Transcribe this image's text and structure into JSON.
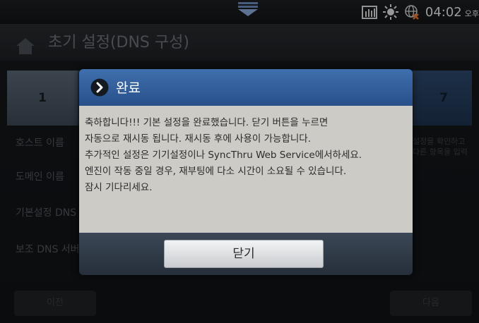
{
  "status_bar": {
    "time": "04:02",
    "ampm": "오후"
  },
  "header": {
    "title": "초기 설정(DNS 구성)"
  },
  "steps": {
    "first": "1",
    "last": "7"
  },
  "form": {
    "rows": [
      "호스트 이름",
      "도메인 이름",
      "기본설정 DNS",
      "보조 DNS 서버"
    ],
    "notes": [
      "설정을 확인하고",
      "다른 항목을 입력"
    ]
  },
  "dialog": {
    "title": "완료",
    "lines": [
      "축하합니다!!!  기본 설정을 완료했습니다. 닫기 버튼을 누르면",
      "자동으로 재시동 됩니다. 재시동 후에 사용이 가능합니다.",
      "추가적인 설정은 기기설정이나 SyncThru Web Service에서하세요.",
      "엔진이 작동 중일 경우, 재부팅에 다소 시간이 소요될 수 있습니다.",
      "잠시 기다리세요."
    ],
    "close_label": "닫기"
  },
  "bottom": {
    "left_label": "이전",
    "right_label": "다음"
  },
  "colors": {
    "dialog_header": "#3f6fad",
    "dialog_body": "#cdcbc5"
  }
}
